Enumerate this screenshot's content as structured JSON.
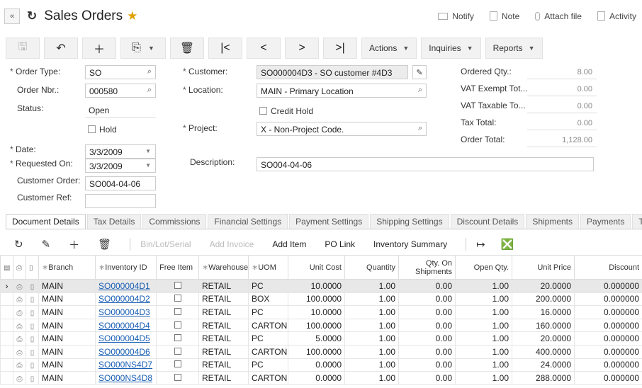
{
  "title": "Sales Orders",
  "top_actions": [
    "Notify",
    "Note",
    "Attach file",
    "Activity"
  ],
  "toolbar": {
    "actions": "Actions",
    "inquiries": "Inquiries",
    "reports": "Reports"
  },
  "form": {
    "order_type_label": "Order Type:",
    "order_type": "SO",
    "order_nbr_label": "Order Nbr.:",
    "order_nbr": "000580",
    "status_label": "Status:",
    "status": "Open",
    "hold_label": "Hold",
    "date_label": "Date:",
    "date": "3/3/2009",
    "requested_on_label": "Requested On:",
    "requested_on": "3/3/2009",
    "customer_order_label": "Customer Order:",
    "customer_order": "SO004-04-06",
    "customer_ref_label": "Customer Ref:",
    "customer_ref": "",
    "customer_label": "Customer:",
    "customer": "SO000004D3 - SO customer #4D3",
    "location_label": "Location:",
    "location": "MAIN - Primary Location",
    "credit_hold_label": "Credit Hold",
    "project_label": "Project:",
    "project": "X - Non-Project Code.",
    "description_label": "Description:",
    "description": "SO004-04-06",
    "ordered_qty_label": "Ordered Qty.:",
    "ordered_qty": "8.00",
    "vat_exempt_label": "VAT Exempt Tot...",
    "vat_exempt": "0.00",
    "vat_taxable_label": "VAT Taxable To...",
    "vat_taxable": "0.00",
    "tax_total_label": "Tax Total:",
    "tax_total": "0.00",
    "order_total_label": "Order Total:",
    "order_total": "1,128.00"
  },
  "tabs": [
    "Document Details",
    "Tax Details",
    "Commissions",
    "Financial Settings",
    "Payment Settings",
    "Shipping Settings",
    "Discount Details",
    "Shipments",
    "Payments",
    "Totals"
  ],
  "grid_toolbar": {
    "bin": "Bin/Lot/Serial",
    "add_invoice": "Add Invoice",
    "add_item": "Add Item",
    "po_link": "PO Link",
    "inventory_summary": "Inventory Summary"
  },
  "columns": {
    "branch": "Branch",
    "inventory_id": "Inventory ID",
    "free_item": "Free Item",
    "warehouse": "Warehouse",
    "uom": "UOM",
    "unit_cost": "Unit Cost",
    "quantity": "Quantity",
    "qty_on_shipments": "Qty. On Shipments",
    "open_qty": "Open Qty.",
    "unit_price": "Unit Price",
    "discount": "Discount"
  },
  "rows": [
    {
      "branch": "MAIN",
      "inventory_id": "SO000004D1",
      "warehouse": "RETAIL",
      "uom": "PC",
      "unit_cost": "10.0000",
      "quantity": "1.00",
      "qty_on_shipments": "0.00",
      "open_qty": "1.00",
      "unit_price": "20.0000",
      "discount": "0.000000"
    },
    {
      "branch": "MAIN",
      "inventory_id": "SO000004D2",
      "warehouse": "RETAIL",
      "uom": "BOX",
      "unit_cost": "100.0000",
      "quantity": "1.00",
      "qty_on_shipments": "0.00",
      "open_qty": "1.00",
      "unit_price": "200.0000",
      "discount": "0.000000"
    },
    {
      "branch": "MAIN",
      "inventory_id": "SO000004D3",
      "warehouse": "RETAIL",
      "uom": "PC",
      "unit_cost": "10.0000",
      "quantity": "1.00",
      "qty_on_shipments": "0.00",
      "open_qty": "1.00",
      "unit_price": "16.0000",
      "discount": "0.000000"
    },
    {
      "branch": "MAIN",
      "inventory_id": "SO000004D4",
      "warehouse": "RETAIL",
      "uom": "CARTON",
      "unit_cost": "100.0000",
      "quantity": "1.00",
      "qty_on_shipments": "0.00",
      "open_qty": "1.00",
      "unit_price": "160.0000",
      "discount": "0.000000"
    },
    {
      "branch": "MAIN",
      "inventory_id": "SO000004D5",
      "warehouse": "RETAIL",
      "uom": "PC",
      "unit_cost": "5.0000",
      "quantity": "1.00",
      "qty_on_shipments": "0.00",
      "open_qty": "1.00",
      "unit_price": "20.0000",
      "discount": "0.000000"
    },
    {
      "branch": "MAIN",
      "inventory_id": "SO000004D6",
      "warehouse": "RETAIL",
      "uom": "CARTON",
      "unit_cost": "100.0000",
      "quantity": "1.00",
      "qty_on_shipments": "0.00",
      "open_qty": "1.00",
      "unit_price": "400.0000",
      "discount": "0.000000"
    },
    {
      "branch": "MAIN",
      "inventory_id": "SO000NS4D7",
      "warehouse": "RETAIL",
      "uom": "PC",
      "unit_cost": "0.0000",
      "quantity": "1.00",
      "qty_on_shipments": "0.00",
      "open_qty": "1.00",
      "unit_price": "24.0000",
      "discount": "0.000000"
    },
    {
      "branch": "MAIN",
      "inventory_id": "SO000NS4D8",
      "warehouse": "RETAIL",
      "uom": "CARTON",
      "unit_cost": "0.0000",
      "quantity": "1.00",
      "qty_on_shipments": "0.00",
      "open_qty": "1.00",
      "unit_price": "288.0000",
      "discount": "0.000000"
    }
  ]
}
